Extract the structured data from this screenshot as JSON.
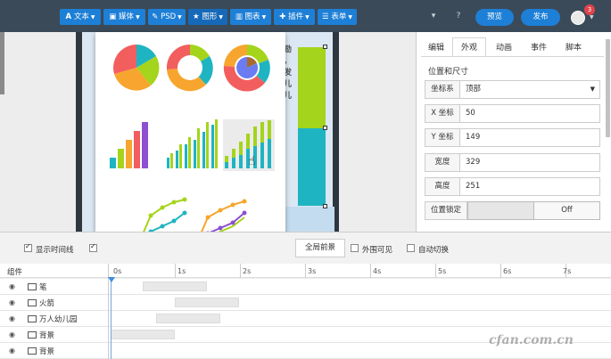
{
  "toolbar": {
    "text": "文本",
    "media": "媒体",
    "psd": "PSD",
    "shape": "图形",
    "chart": "图表",
    "plugin": "插件",
    "form": "表单",
    "preview": "预览",
    "publish": "发布",
    "notifications": "3"
  },
  "canvas": {
    "text_lines": [
      "励",
      "，",
      "发",
      "儿",
      "儿"
    ]
  },
  "props": {
    "tabs": [
      "编辑",
      "外观",
      "动画",
      "事件",
      "脚本"
    ],
    "active_tab": "外观",
    "section_title": "位置和尺寸",
    "coord_label": "坐标系",
    "coord_value": "顶部",
    "x_label": "X 坐标",
    "x_value": "50",
    "y_label": "Y 坐标",
    "y_value": "149",
    "width_label": "宽度",
    "width_value": "329",
    "height_label": "高度",
    "height_value": "251",
    "lock_label": "位置锁定",
    "lock_value": "Off"
  },
  "timeline_controls": {
    "show_timeline": "显示时间线",
    "global_foreground": "全局前景",
    "outside_visible": "外围可见",
    "auto_switch": "自动切换"
  },
  "timeline": {
    "header": "组件",
    "ticks": [
      "0s",
      "1s",
      "2s",
      "3s",
      "4s",
      "5s",
      "6s",
      "7s"
    ],
    "layers": [
      "笔",
      "火箭",
      "万人幼儿园",
      "背景",
      "背景"
    ]
  },
  "watermark": "cfan.com.cn",
  "colors": {
    "topbar": "#3b4a58",
    "accent": "#1d7fd6",
    "chart_red": "#f25e5e",
    "chart_orange": "#f7a52e",
    "chart_green": "#a4d41b",
    "chart_teal": "#1fb4c2",
    "chart_purple": "#8e4fd0"
  }
}
